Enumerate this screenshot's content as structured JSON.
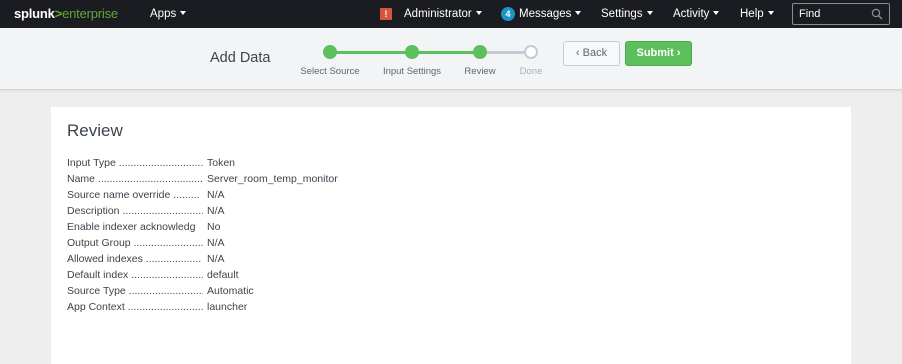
{
  "topnav": {
    "logo": {
      "splunk": "splunk",
      "gt": ">",
      "product": "enterprise"
    },
    "apps_label": "Apps",
    "admin_alert_icon": "!",
    "admin_label": "Administrator",
    "messages_count": "4",
    "messages_label": "Messages",
    "settings_label": "Settings",
    "activity_label": "Activity",
    "help_label": "Help",
    "find_placeholder": "Find"
  },
  "wizard": {
    "title": "Add Data",
    "steps": [
      {
        "label": "Select Source",
        "status": "done"
      },
      {
        "label": "Input Settings",
        "status": "done"
      },
      {
        "label": "Review",
        "status": "done"
      },
      {
        "label": "Done",
        "status": "todo"
      }
    ],
    "back_label": "Back",
    "submit_label": "Submit"
  },
  "review": {
    "title": "Review",
    "rows": [
      {
        "key": "Input Type ...............................",
        "value": "Token"
      },
      {
        "key": "Name .......................................",
        "value": "Server_room_temp_monitor"
      },
      {
        "key": "Source name override .........",
        "value": "N/A"
      },
      {
        "key": "Description ............................",
        "value": "N/A"
      },
      {
        "key": "Enable indexer acknowledg",
        "value": "No"
      },
      {
        "key": "Output Group .........................",
        "value": "N/A"
      },
      {
        "key": "Allowed indexes ...................",
        "value": "N/A"
      },
      {
        "key": "Default index .........................",
        "value": "default"
      },
      {
        "key": "Source Type ...........................",
        "value": "Automatic"
      },
      {
        "key": "App Context ..........................",
        "value": "launcher"
      }
    ]
  },
  "colors": {
    "nav_bg": "#1a1c21",
    "brand_green": "#65a637",
    "step_green": "#5cc05c",
    "alert_red": "#d6563c",
    "badge_blue": "#1e93c6"
  }
}
